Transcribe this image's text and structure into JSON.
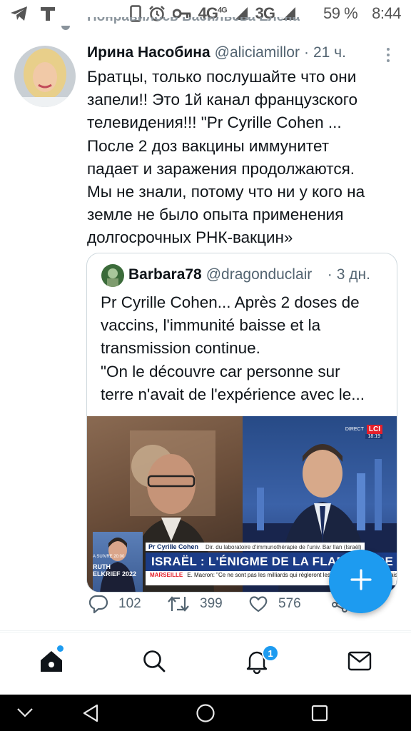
{
  "status_bar": {
    "network_1": "4G",
    "network_1_sup": "4G",
    "network_2": "3G",
    "battery": "59 %",
    "time": "8:44",
    "icons": [
      "telegram-icon",
      "tass-t-icon",
      "phone-icon",
      "alarm-icon",
      "key-icon",
      "signal-icon",
      "signal-icon"
    ]
  },
  "previous_row": {
    "text": "Понравилось Васильева Елена"
  },
  "tweet": {
    "author_name": "Ирина Насобина",
    "handle": "@aliciamillor",
    "dot": "·",
    "time": "21 ч.",
    "text_lines": [
      "Братцы, только послушайте что они",
      "запели!! Это 1й канал французского",
      "телевидения!!!   \"Pr Cyrille Cohen ...",
      "После 2 доз вакцины иммунитет",
      "падает и заражения продолжаются.",
      "Мы не знали, потому что ни у кого на",
      "земле не было опыта применения",
      "долгосрочных РНК-вакцин»"
    ],
    "quote": {
      "author_name": "Barbara78",
      "handle": "@dragonduclair",
      "dot": "·",
      "time": "3 дн.",
      "text_lines": [
        "Pr Cyrille Cohen... Après 2 doses de",
        "vaccins, l'immunité baisse et la",
        "transmission continue.",
        "\"On le découvre car personne sur",
        "terre n'avait de l'expérience avec le..."
      ],
      "video": {
        "channel_direct": "DIRECT",
        "channel": "LCI",
        "clock": "18:19",
        "lower_third_name": "Pr Cyrille Cohen",
        "lower_third_role": "Dir. du laboratoire d'immunothérapie de l'univ. Bar Ilan (Israël)",
        "headline": "ISRAËL : L'ÉNIGME DE LA FLAMBÉE DE L'ÉPIDÉMIE",
        "ticker_city": "MARSEILLE",
        "ticker_text": "E. Macron: \"Ce ne sont pas les milliards qui règleront les problèmes de la ville mais votre capacité à faire ensemble\" (sources concordantes)",
        "ad_tag": "A SUIVRE 20:00",
        "ad_name": "RUTH ELKRIEF 2022"
      }
    },
    "actions": {
      "replies": "102",
      "retweets": "399",
      "likes": "576"
    }
  },
  "fab": {
    "icon": "plus-icon",
    "color": "#1d9bf0"
  },
  "bottom_nav": {
    "items": [
      "home-icon",
      "search-icon",
      "notifications-icon",
      "messages-icon"
    ],
    "notification_badge": "1"
  },
  "colors": {
    "accent": "#1d9bf0",
    "secondary_text": "#536471",
    "border": "#cfd9de"
  }
}
